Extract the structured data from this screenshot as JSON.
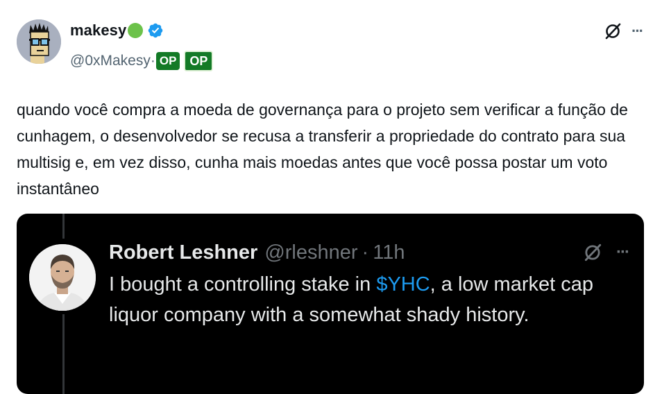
{
  "tweet": {
    "author_name": "makesy",
    "handle": "@0xMakesy",
    "separator": "·",
    "badges": [
      "OP",
      "OP"
    ],
    "text": "quando você compra a moeda de governança para o projeto sem verificar a função de cunhagem, o desenvolvedor se recusa a transferir a propriedade do contrato para sua multisig e, em vez disso, cunha mais moedas antes que você possa postar um voto instantâneo",
    "more_glyph": "···"
  },
  "quoted": {
    "author_name": "Robert Leshner",
    "handle": "@rleshner",
    "separator": "·",
    "time": "11h",
    "text_before": "I bought a controlling stake in ",
    "cashtag": "$YHC",
    "text_after": ", a low market cap liquor company with a somewhat shady history.",
    "more_glyph": "···"
  },
  "colors": {
    "op_badge": "#137a26",
    "verified": "#1d9bf0",
    "cashtag": "#1d9bf0",
    "quote_bg": "#000000"
  },
  "icons": [
    "avatar-pixel-art",
    "green-circle",
    "verified-badge-icon",
    "grok-icon",
    "more-icon"
  ]
}
